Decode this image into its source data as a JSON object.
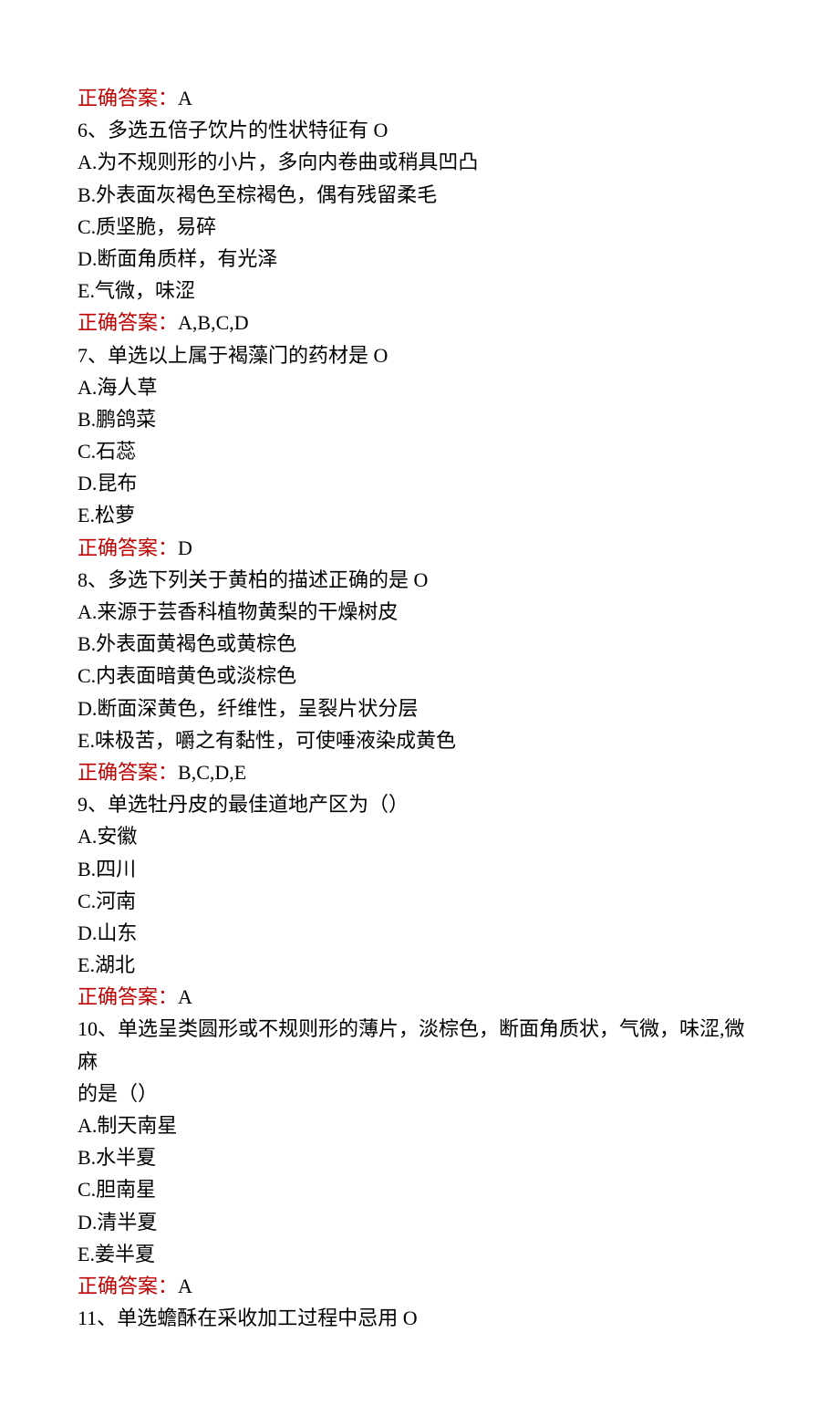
{
  "answer_label": "正确答案：",
  "items": [
    {
      "answer": "A",
      "num": "6、",
      "qtype": "多选",
      "stem_lines": [
        "五倍子饮片的性状特征有 O"
      ],
      "options": [
        "A.为不规则形的小片，多向内卷曲或稍具凹凸",
        "B.外表面灰褐色至棕褐色，偶有残留柔毛",
        "C.质坚脆，易碎",
        "D.断面角质样，有光泽",
        "E.气微，味涩"
      ],
      "opt_answer": "A,B,C,D"
    },
    {
      "num": "7、",
      "qtype": "单选",
      "stem_lines": [
        "以上属于褐藻门的药材是 O"
      ],
      "options": [
        "A.海人草",
        "B.鹏鸽菜",
        "C.石蕊",
        "D.昆布",
        "E.松萝"
      ],
      "opt_answer": "D"
    },
    {
      "num": "8、",
      "qtype": "多选",
      "stem_lines": [
        "下列关于黄柏的描述正确的是 O"
      ],
      "options": [
        "A.来源于芸香科植物黄梨的干燥树皮",
        "B.外表面黄褐色或黄棕色",
        "C.内表面暗黄色或淡棕色",
        "D.断面深黄色，纤维性，呈裂片状分层",
        "E.味极苦，嚼之有黏性，可使唾液染成黄色"
      ],
      "opt_answer": "B,C,D,E"
    },
    {
      "num": "9、",
      "qtype": "单选",
      "stem_lines": [
        "牡丹皮的最佳道地产区为（）"
      ],
      "options": [
        "A.安徽",
        "B.四川",
        "C.河南",
        "D.山东",
        "E.湖北"
      ],
      "opt_answer": "A"
    },
    {
      "num": "10、",
      "qtype": "单选",
      "stem_lines": [
        "呈类圆形或不规则形的薄片，淡棕色，断面角质状，气微，味涩,微麻",
        "的是（）"
      ],
      "options": [
        "A.制天南星",
        "B.水半夏",
        "C.胆南星",
        "D.清半夏",
        "E.姜半夏"
      ],
      "opt_answer": "A"
    },
    {
      "num": "11、",
      "qtype": "单选",
      "stem_lines": [
        "蟾酥在采收加工过程中忌用 O"
      ],
      "options": [],
      "opt_answer": null
    }
  ]
}
